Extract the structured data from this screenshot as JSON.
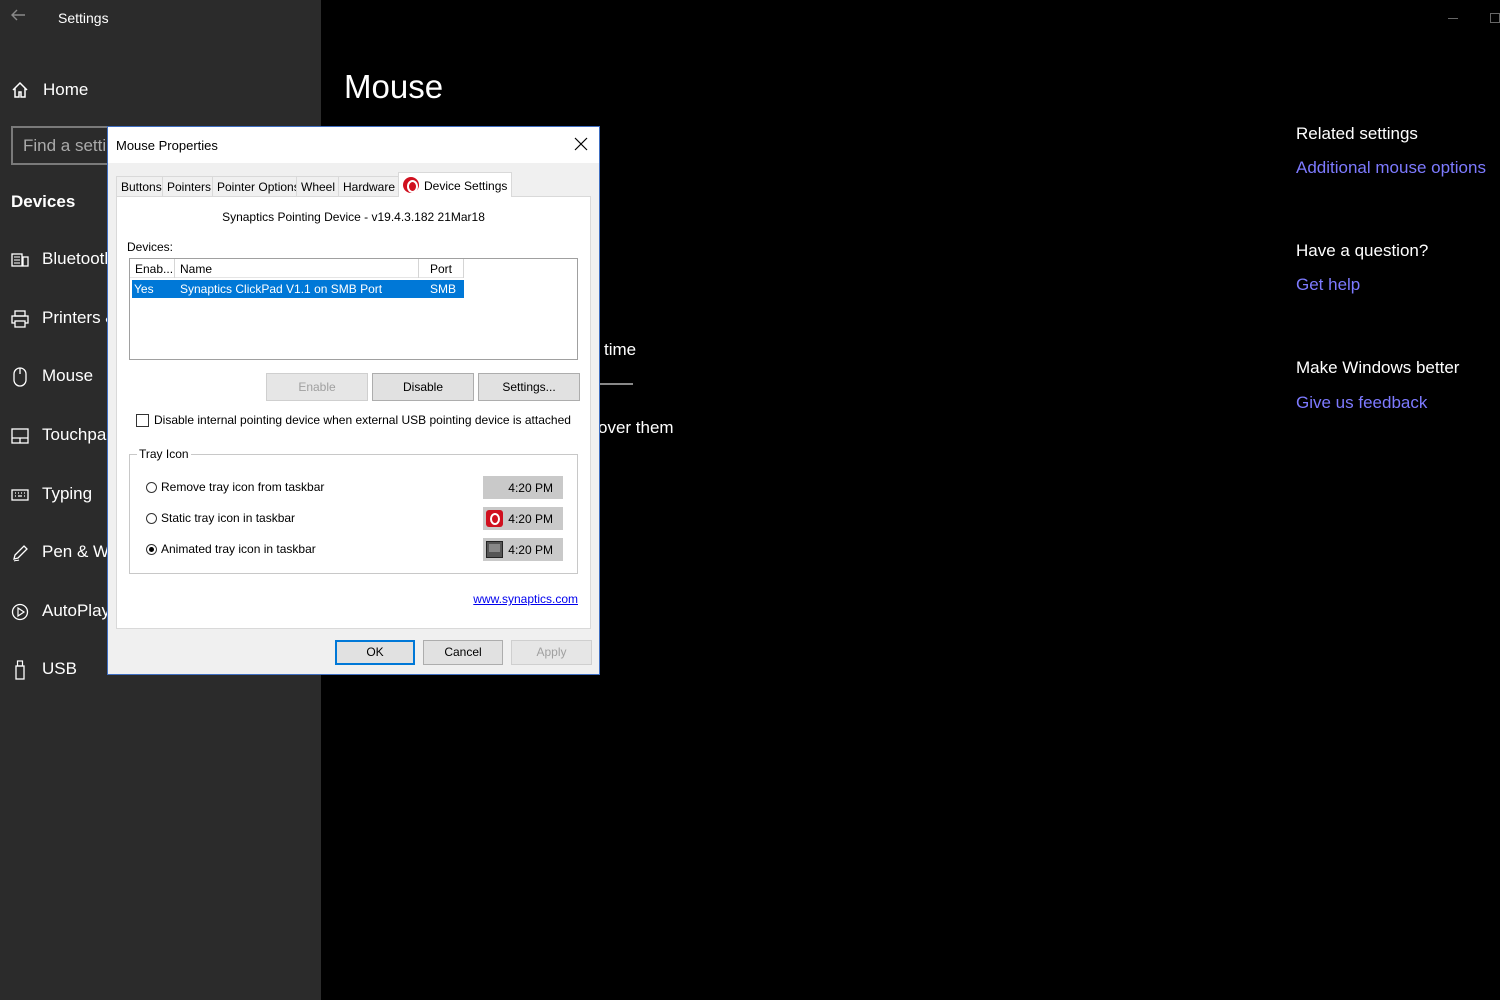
{
  "window": {
    "app_title": "Settings"
  },
  "sidebar": {
    "home_label": "Home",
    "search_placeholder": "Find a setting",
    "section": "Devices",
    "items": [
      {
        "label": "Bluetooth & other devices",
        "icon": "bluetooth-devices-icon"
      },
      {
        "label": "Printers & scanners",
        "icon": "printer-icon"
      },
      {
        "label": "Mouse",
        "icon": "mouse-icon"
      },
      {
        "label": "Touchpad",
        "icon": "touchpad-icon"
      },
      {
        "label": "Typing",
        "icon": "keyboard-icon"
      },
      {
        "label": "Pen & Windows Ink",
        "icon": "pen-icon"
      },
      {
        "label": "AutoPlay",
        "icon": "autoplay-icon"
      },
      {
        "label": "USB",
        "icon": "usb-icon"
      }
    ]
  },
  "main": {
    "title": "Mouse",
    "partial_text_1": "time",
    "partial_text_2": "over them"
  },
  "related": {
    "related_heading": "Related settings",
    "related_link": "Additional mouse options",
    "question_heading": "Have a question?",
    "question_link": "Get help",
    "better_heading": "Make Windows better",
    "better_link": "Give us feedback"
  },
  "dialog": {
    "title": "Mouse Properties",
    "tabs": [
      "Buttons",
      "Pointers",
      "Pointer Options",
      "Wheel",
      "Hardware",
      "Device Settings"
    ],
    "active_tab": "Device Settings",
    "driver_title": "Synaptics Pointing Device - v19.4.3.182 21Mar18",
    "devices_label": "Devices:",
    "columns": [
      "Enab...",
      "Name",
      "Port"
    ],
    "rows": [
      {
        "enabled": "Yes",
        "name": "Synaptics ClickPad V1.1 on SMB Port",
        "port": "SMB"
      }
    ],
    "enable_button": "Enable",
    "disable_button": "Disable",
    "settings_button": "Settings...",
    "disable_internal_label": "Disable internal pointing device when external USB pointing device is attached",
    "disable_internal_checked": false,
    "tray_group_label": "Tray Icon",
    "tray_options": [
      {
        "label": "Remove tray icon from taskbar",
        "preview_time": "4:20 PM",
        "checked": false
      },
      {
        "label": "Static tray icon in taskbar",
        "preview_time": "4:20 PM",
        "checked": false
      },
      {
        "label": "Animated tray icon in taskbar",
        "preview_time": "4:20 PM",
        "checked": true
      }
    ],
    "link": "www.synaptics.com",
    "ok_button": "OK",
    "cancel_button": "Cancel",
    "apply_button": "Apply"
  }
}
